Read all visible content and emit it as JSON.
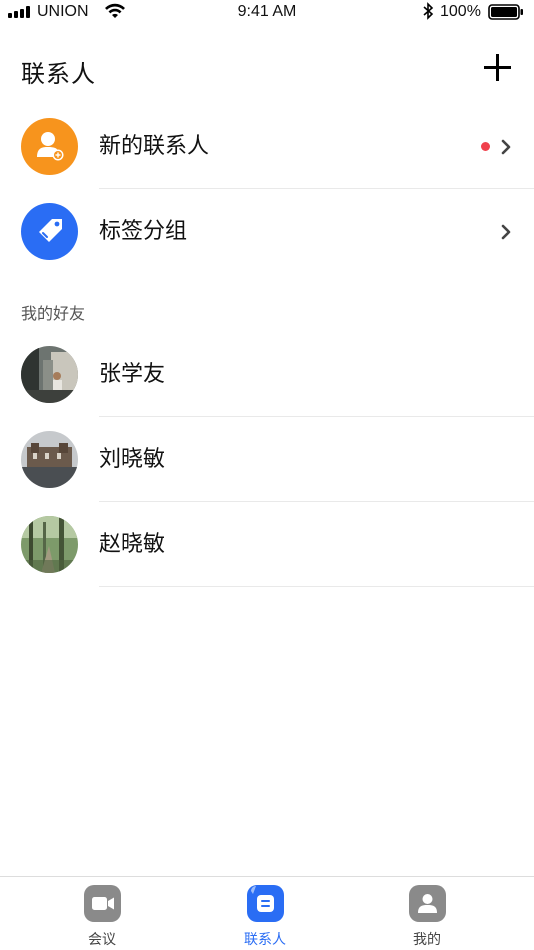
{
  "status_bar": {
    "carrier": "UNION",
    "time": "9:41 AM",
    "battery": "100%"
  },
  "header": {
    "title": "联系人",
    "add_icon": "plus-icon"
  },
  "menu": [
    {
      "label": "新的联系人",
      "icon": "add-contact-icon",
      "color": "#f7941d",
      "has_dot": true,
      "dot_color": "#f0414c"
    },
    {
      "label": "标签分组",
      "icon": "tag-icon",
      "color": "#2a6df4",
      "has_dot": false
    }
  ],
  "friends_section": {
    "title": "我的好友",
    "friends": [
      {
        "name": "张学友",
        "avatar": "photo-avatar"
      },
      {
        "name": "刘晓敏",
        "avatar": "photo-avatar"
      },
      {
        "name": "赵晓敏",
        "avatar": "photo-avatar"
      }
    ]
  },
  "tab_bar": {
    "tabs": [
      {
        "label": "会议",
        "icon": "video-camera-icon",
        "active": false
      },
      {
        "label": "联系人",
        "icon": "contacts-icon",
        "active": true
      },
      {
        "label": "我的",
        "icon": "profile-icon",
        "active": false
      }
    ],
    "active_color": "#2a6df4",
    "inactive_color": "#8a8a8a"
  }
}
